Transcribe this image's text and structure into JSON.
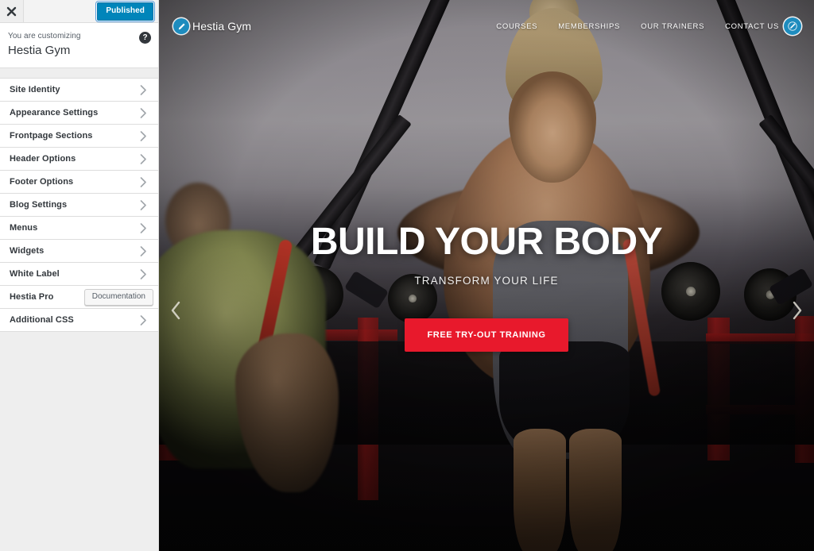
{
  "customizer": {
    "close_label": "Close customizer",
    "close_icon": "close-x-icon",
    "publish_label": "Published",
    "customizing_label": "You are customizing",
    "site_title": "Hestia Gym",
    "help_icon": "help-question-icon",
    "help_label": "?",
    "chevron_icon": "chevron-right-icon",
    "panels": [
      {
        "label": "Site Identity",
        "kind": "panel"
      },
      {
        "label": "Appearance Settings",
        "kind": "panel"
      },
      {
        "label": "Frontpage Sections",
        "kind": "panel"
      },
      {
        "label": "Header Options",
        "kind": "panel"
      },
      {
        "label": "Footer Options",
        "kind": "panel"
      },
      {
        "label": "Blog Settings",
        "kind": "panel"
      },
      {
        "label": "Menus",
        "kind": "panel"
      },
      {
        "label": "Widgets",
        "kind": "panel"
      },
      {
        "label": "White Label",
        "kind": "panel"
      },
      {
        "label": "Hestia Pro",
        "kind": "button",
        "button_label": "Documentation"
      },
      {
        "label": "Additional CSS",
        "kind": "panel"
      }
    ]
  },
  "preview": {
    "brand": {
      "name": "Hestia Gym",
      "mark_icon": "pencil-edit-icon"
    },
    "nav": [
      {
        "label": "COURSES"
      },
      {
        "label": "MEMBERSHIPS"
      },
      {
        "label": "OUR TRAINERS"
      },
      {
        "label": "CONTACT US"
      }
    ],
    "edit_shortcut_icon": "pencil-edit-icon",
    "hero": {
      "title": "BUILD YOUR BODY",
      "subtitle": "TRANSFORM YOUR LIFE",
      "cta_label": "FREE TRY-OUT TRAINING"
    },
    "slider": {
      "prev_icon": "chevron-left-icon",
      "next_icon": "chevron-right-icon"
    }
  },
  "colors": {
    "publish_blue": "#0085ba",
    "brand_blue": "#1e8cbe",
    "cta_red": "#e8192c",
    "sidebar_bg": "#eeeeee",
    "panel_bg": "#ffffff",
    "text_dark": "#32373c"
  }
}
